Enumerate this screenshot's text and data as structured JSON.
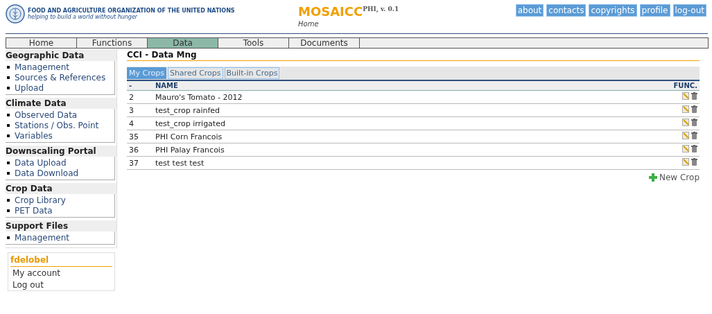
{
  "header": {
    "org_name": "FOOD AND AGRICULTURE ORGANIZATION OF THE UNITED NATIONS",
    "org_tagline": "helping to build a world without hunger",
    "app_title": "MOSAICC",
    "app_version": "PHI, v. 0.1",
    "breadcrumb": "Home",
    "links": [
      "about",
      "contacts",
      "copyrights",
      "profile",
      "log-out"
    ]
  },
  "nav": [
    {
      "label": "Home",
      "selected": false
    },
    {
      "label": "Functions",
      "selected": false
    },
    {
      "label": "Data",
      "selected": true
    },
    {
      "label": "Tools",
      "selected": false
    },
    {
      "label": "Documents",
      "selected": false
    }
  ],
  "sidebar": {
    "sections": [
      {
        "title": "Geographic Data",
        "items": [
          "Management",
          "Sources & References",
          "Upload"
        ]
      },
      {
        "title": "Climate Data",
        "items": [
          "Observed Data",
          "Stations / Obs. Point",
          "Variables"
        ]
      },
      {
        "title": "Downscaling Portal",
        "items": [
          "Data Upload",
          "Data Download"
        ]
      },
      {
        "title": "Crop Data",
        "items": [
          "Crop Library",
          "PET Data"
        ]
      },
      {
        "title": "Support Files",
        "items": [
          "Management"
        ]
      }
    ],
    "user": {
      "name": "fdelobel",
      "links": [
        "My account",
        "Log out"
      ]
    }
  },
  "main": {
    "title": "CCI - Data Mng",
    "tabs": [
      {
        "label": "My Crops",
        "selected": true
      },
      {
        "label": "Shared Crops",
        "selected": false
      },
      {
        "label": "Built-in Crops",
        "selected": false
      }
    ],
    "table": {
      "columns": [
        "-",
        "NAME",
        "FUNC."
      ],
      "rows": [
        {
          "id": "2",
          "name": "Mauro's Tomato - 2012"
        },
        {
          "id": "3",
          "name": "test_crop rainfed"
        },
        {
          "id": "4",
          "name": "test_crop irrigated"
        },
        {
          "id": "35",
          "name": "PHI Corn Francois"
        },
        {
          "id": "36",
          "name": "PHI Palay Francois"
        },
        {
          "id": "37",
          "name": "test test test"
        }
      ]
    },
    "new_button": "New Crop"
  }
}
